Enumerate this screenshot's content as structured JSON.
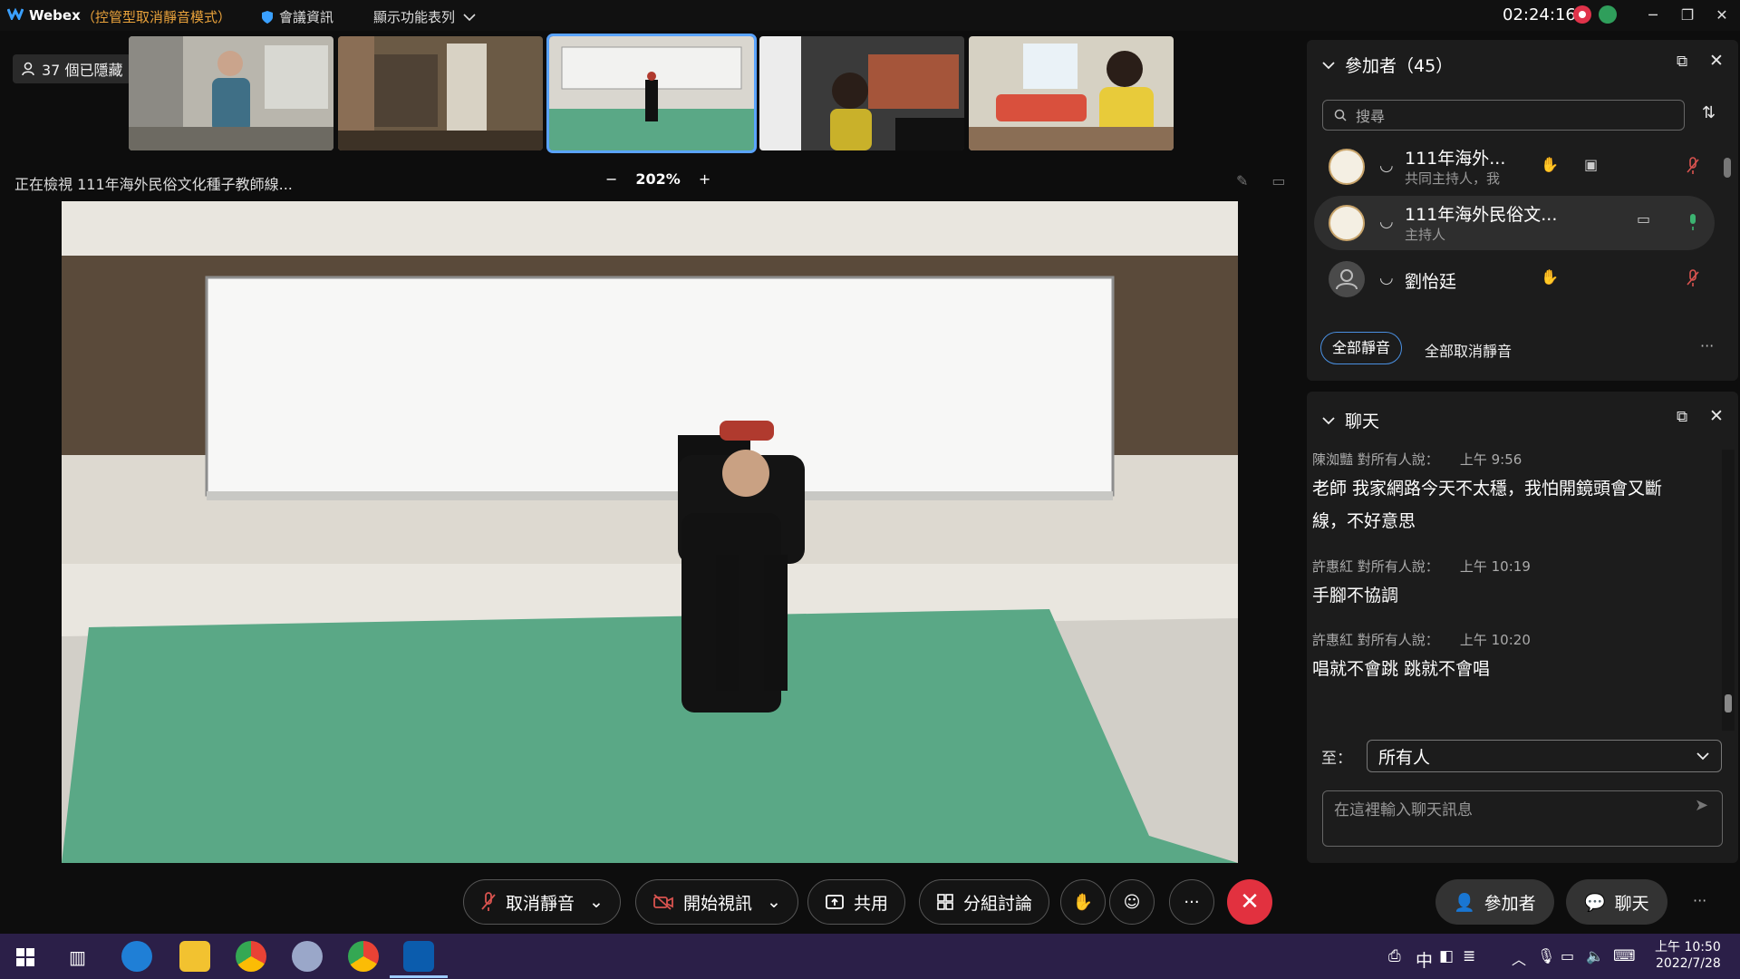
{
  "titlebar": {
    "app_name": "Webex",
    "mode": "（控管型取消靜音模式）",
    "meeting_info": "會議資訊",
    "feature_list": "顯示功能表列",
    "clock": "02:24:16"
  },
  "thumbnails": {
    "hidden_count": "37 個已隱藏"
  },
  "view_bar": {
    "viewing_label": "正在檢視 111年海外民俗文化種子教師線...",
    "zoom": "202%",
    "zoom_out": "−",
    "zoom_in": "+"
  },
  "participants": {
    "title": "參加者（45）",
    "search_placeholder": "搜尋",
    "list": [
      {
        "name": "111年海外...",
        "role": "共同主持人，我"
      },
      {
        "name": "111年海外民俗文...",
        "role": "主持人"
      },
      {
        "name": "劉怡廷",
        "role": ""
      }
    ],
    "mute_all": "全部靜音",
    "unmute_all": "全部取消靜音",
    "more": "···"
  },
  "chat": {
    "title": "聊天",
    "messages": [
      {
        "meta": "陳洳豔 對所有人說：",
        "time": "上午 9:56",
        "body_1": "老師 我家網路今天不太穩，我怕開鏡頭會又斷",
        "body_2": "線，不好意思"
      },
      {
        "meta": "許惠紅 對所有人說：",
        "time": "上午 10:19",
        "body_1": "手腳不協調"
      },
      {
        "meta": "許惠紅 對所有人說：",
        "time": "上午 10:20",
        "body_1": "唱就不會跳 跳就不會唱"
      }
    ],
    "to_label": "至：",
    "to_value": "所有人",
    "input_placeholder": "在這裡輸入聊天訊息"
  },
  "controls": {
    "unmute": "取消靜音",
    "start_video": "開始視訊",
    "share": "共用",
    "breakout": "分組討論",
    "more": "···",
    "participants": "參加者",
    "chat": "聊天",
    "overflow": "···"
  },
  "taskbar": {
    "ime": "中",
    "time": "上午 10:50",
    "date": "2022/7/28"
  },
  "colors": {
    "accent": "#4a90e2",
    "end_call": "#e2313f",
    "mode_text": "#e9a23b",
    "mute_red": "#d9534f",
    "live_green": "#3cb371",
    "green_mat": "#5aa886"
  }
}
